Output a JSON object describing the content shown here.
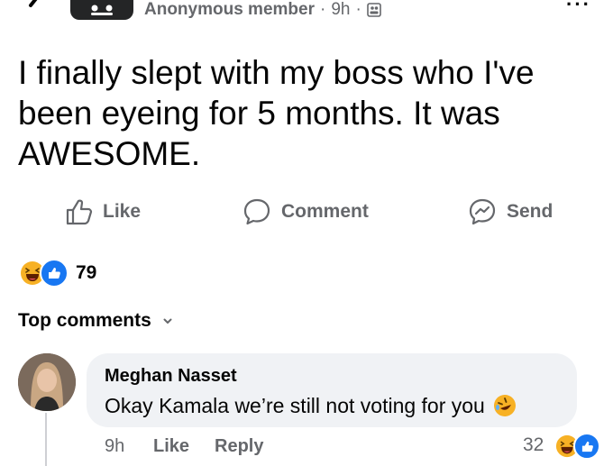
{
  "post": {
    "author": "Anonymous member",
    "time": "9h",
    "separator": "·",
    "more": "···",
    "text": "I finally slept with my boss who I've been eyeing for 5 months. It was AWESOME."
  },
  "actions": {
    "like": "Like",
    "comment": "Comment",
    "send": "Send"
  },
  "reactions": {
    "count": "79",
    "types": [
      "haha",
      "like"
    ]
  },
  "comments_header": {
    "label": "Top comments"
  },
  "comment": {
    "name": "Meghan Nasset",
    "text": "Okay Kamala we’re still not voting for you",
    "time": "9h",
    "like": "Like",
    "reply": "Reply",
    "reaction_count": "32",
    "emoji": "rofl-icon"
  },
  "colors": {
    "secondary_text": "#65676b",
    "like_blue": "#1877f2",
    "bubble_bg": "#f0f2f5",
    "haha_yellow": "#f7b125"
  }
}
